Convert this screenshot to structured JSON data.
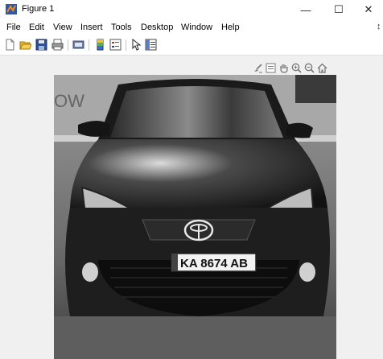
{
  "window": {
    "title": "Figure 1",
    "minimize_glyph": "—",
    "maximize_glyph": "☐",
    "close_glyph": "✕"
  },
  "menu": {
    "items": [
      "File",
      "Edit",
      "View",
      "Insert",
      "Tools",
      "Desktop",
      "Window",
      "Help"
    ],
    "overflow_glyph": "↕"
  },
  "toolbar": {
    "icons": [
      "new-figure-icon",
      "open-file-icon",
      "save-icon",
      "print-icon",
      "link-plot-icon",
      "colorbar-icon",
      "legend-icon",
      "edit-plot-arrow-icon",
      "property-inspector-icon"
    ]
  },
  "axes_toolbar": {
    "icons": [
      "brush-icon",
      "data-tips-icon",
      "pan-hand-icon",
      "zoom-in-icon",
      "zoom-out-icon",
      "restore-home-icon"
    ]
  },
  "image": {
    "plate_text": "KA 8674 AB",
    "wall_text": "OW",
    "colors": {
      "dark": "#1e1e1e",
      "mid": "#6b6b6b",
      "light": "#bdbdbd"
    }
  }
}
